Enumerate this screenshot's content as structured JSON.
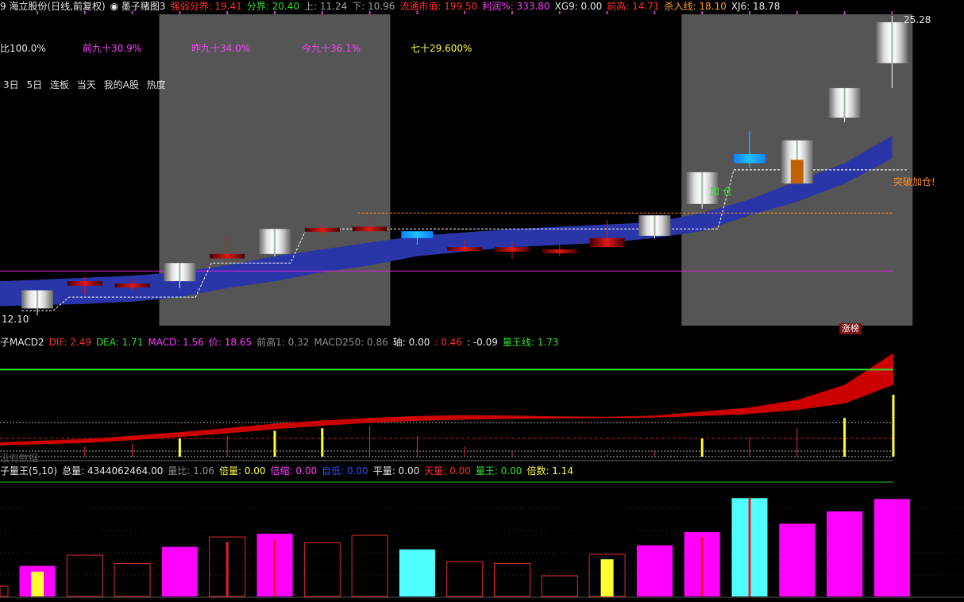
{
  "header": {
    "items": [
      {
        "text": "9 海立股份(日线,前复权)",
        "color": "#e8e8e8"
      },
      {
        "text": "◉ 墨子赌图3",
        "color": "#e8e8e8"
      },
      {
        "text": "强弱分界: 19.41",
        "color": "#ff3030"
      },
      {
        "text": "分界: 20.40",
        "color": "#30e030"
      },
      {
        "text": "上: 11.24",
        "color": "#a0a0a0"
      },
      {
        "text": "下: 10.96",
        "color": "#a0a0a0"
      },
      {
        "text": "流通市值: 199.50",
        "color": "#ff3030"
      },
      {
        "text": "利润%: 333.80",
        "color": "#ff40ff"
      },
      {
        "text": "XG9: 0.00",
        "color": "#e8e8e8"
      },
      {
        "text": "前高: 14.71",
        "color": "#ff3030"
      },
      {
        "text": "杀入线: 18.10",
        "color": "#ffa020"
      },
      {
        "text": "XJ6: 18.78",
        "color": "#e8e8e8"
      }
    ]
  },
  "pct_labels": [
    {
      "text": "比100.0%",
      "color": "#e8e8e8"
    },
    {
      "text": "前九十30.9%",
      "color": "#ff40ff"
    },
    {
      "text": "昨九十34.0%",
      "color": "#ff40ff"
    },
    {
      "text": "今九十36.1%",
      "color": "#ff40ff"
    },
    {
      "text": "七十29.600%",
      "color": "#ffff40"
    }
  ],
  "quick_tabs": [
    "3日",
    "5日",
    "连板",
    "当天",
    "我的A股",
    "热度"
  ],
  "price": {
    "high_label": "25.28",
    "low_label": "12.10",
    "breakout_label": "突破加仓!",
    "add_label": "加 仓",
    "limit_up_badge": "涨榜",
    "candles": [
      {
        "o": 12.4,
        "h": 12.8,
        "l": 12.1,
        "c": 13.2,
        "style": "white"
      },
      {
        "o": 13.4,
        "h": 13.8,
        "l": 13.0,
        "c": 13.6,
        "style": "red"
      },
      {
        "o": 13.4,
        "h": 13.7,
        "l": 13.2,
        "c": 13.5,
        "style": "red"
      },
      {
        "o": 13.6,
        "h": 14.4,
        "l": 13.3,
        "c": 14.4,
        "style": "white"
      },
      {
        "o": 14.6,
        "h": 15.6,
        "l": 14.4,
        "c": 14.8,
        "style": "red"
      },
      {
        "o": 14.8,
        "h": 15.9,
        "l": 14.7,
        "c": 15.9,
        "style": "white"
      },
      {
        "o": 15.9,
        "h": 16.1,
        "l": 15.6,
        "c": 15.95,
        "style": "red"
      },
      {
        "o": 15.8,
        "h": 16.6,
        "l": 15.7,
        "c": 16.0,
        "style": "red"
      },
      {
        "o": 15.5,
        "h": 15.6,
        "l": 15.2,
        "c": 15.8,
        "style": "cyan"
      },
      {
        "o": 15.1,
        "h": 15.4,
        "l": 14.9,
        "c": 15.0,
        "style": "red"
      },
      {
        "o": 15.1,
        "h": 15.3,
        "l": 14.6,
        "c": 14.9,
        "style": "red"
      },
      {
        "o": 15.0,
        "h": 15.2,
        "l": 14.7,
        "c": 14.9,
        "style": "red"
      },
      {
        "o": 15.5,
        "h": 16.3,
        "l": 15.1,
        "c": 15.1,
        "style": "red"
      },
      {
        "o": 15.6,
        "h": 16.5,
        "l": 15.5,
        "c": 16.5,
        "style": "white"
      },
      {
        "o": 17.0,
        "h": 18.4,
        "l": 16.8,
        "c": 18.4,
        "style": "white"
      },
      {
        "o": 18.8,
        "h": 20.2,
        "l": 18.6,
        "c": 19.2,
        "style": "cyan"
      },
      {
        "o": 17.9,
        "h": 19.8,
        "l": 17.9,
        "c": 19.8,
        "style": "white"
      },
      {
        "o": 20.8,
        "h": 22.1,
        "l": 20.6,
        "c": 22.1,
        "style": "white"
      },
      {
        "o": 23.2,
        "h": 25.28,
        "l": 22.1,
        "c": 25.0,
        "style": "white"
      }
    ],
    "band_upper": [
      13.6,
      13.75,
      13.85,
      14.0,
      14.3,
      14.7,
      15.0,
      15.3,
      15.6,
      15.75,
      15.9,
      16.0,
      16.1,
      16.2,
      16.6,
      17.2,
      18.0,
      18.8,
      20.0
    ],
    "band_lower": [
      12.5,
      12.6,
      12.7,
      12.9,
      13.3,
      13.6,
      14.0,
      14.3,
      14.7,
      14.9,
      15.1,
      15.2,
      15.3,
      15.5,
      15.8,
      16.5,
      17.1,
      17.9,
      19.0
    ],
    "stair": [
      12.3,
      12.9,
      12.9,
      12.9,
      14.4,
      14.4,
      15.9,
      15.9,
      15.9,
      15.9,
      15.9,
      15.9,
      15.9,
      15.9,
      15.9,
      18.5,
      18.5,
      18.5,
      18.5
    ],
    "resistance": 16.6,
    "support": 14.05,
    "shaded": [
      [
        3,
        7
      ],
      [
        14,
        18
      ]
    ]
  },
  "macd": {
    "header": [
      {
        "text": "子MACD2",
        "color": "#e8e8e8"
      },
      {
        "text": "DIF: 2.49",
        "color": "#ff3030"
      },
      {
        "text": "DEA: 1.71",
        "color": "#30e030"
      },
      {
        "text": "MACD: 1.56",
        "color": "#ff40ff"
      },
      {
        "text": "价: 18.65",
        "color": "#ff40ff"
      },
      {
        "text": "前高1: 0.32",
        "color": "#909090"
      },
      {
        "text": "MACD250: 0.86",
        "color": "#909090"
      },
      {
        "text": "轴: 0.00",
        "color": "#e8e8e8"
      },
      {
        "text": ": 0.46",
        "color": "#ff3030"
      },
      {
        "text": ": -0.09",
        "color": "#e8e8e8"
      },
      {
        "text": "量王线: 1.73",
        "color": "#30e030"
      }
    ],
    "watermark": "没有数据",
    "dif": [
      0.3,
      0.38,
      0.46,
      0.55,
      0.65,
      0.76,
      0.84,
      0.9,
      0.95,
      0.97,
      0.96,
      0.94,
      0.93,
      0.96,
      1.06,
      1.16,
      1.35,
      1.72,
      2.49
    ],
    "dea": [
      0.22,
      0.28,
      0.35,
      0.43,
      0.52,
      0.62,
      0.71,
      0.78,
      0.83,
      0.86,
      0.88,
      0.89,
      0.9,
      0.91,
      0.95,
      1.0,
      1.1,
      1.26,
      1.71
    ],
    "bars": [
      0.0,
      0.2,
      0.25,
      0.35,
      0.4,
      0.5,
      0.55,
      0.6,
      0.4,
      0.2,
      0.1,
      0.06,
      0.04,
      0.1,
      0.35,
      0.38,
      0.55,
      0.75,
      1.2
    ],
    "bar_yellow": [
      false,
      false,
      false,
      true,
      false,
      true,
      true,
      false,
      false,
      false,
      false,
      false,
      false,
      false,
      true,
      false,
      false,
      true,
      true
    ],
    "green_line": 2.1
  },
  "volume": {
    "header": [
      {
        "text": "子量王(5,10)",
        "color": "#e8e8e8"
      },
      {
        "text": "总量: 4344062464.00",
        "color": "#e8e8e8"
      },
      {
        "text": "量比: 1.06",
        "color": "#909090"
      },
      {
        "text": "倍量: 0.00",
        "color": "#ffff40"
      },
      {
        "text": "倍缩: 0.00",
        "color": "#ff40ff"
      },
      {
        "text": "自低: 0.00",
        "color": "#3050ff"
      },
      {
        "text": "平量: 0.00",
        "color": "#e8e8e8"
      },
      {
        "text": "天量: 0.00",
        "color": "#ff3030"
      },
      {
        "text": "量王: 0.00",
        "color": "#30e030"
      },
      {
        "text": "倍数: 1.14",
        "color": "#ffff40"
      }
    ],
    "values": [
      37,
      50,
      40,
      60,
      72,
      76,
      65,
      74,
      57,
      42,
      40,
      25,
      51,
      62,
      78,
      119,
      88,
      103,
      118
    ],
    "style": [
      "magenta",
      "hollow",
      "hollow",
      "magenta",
      "hollow",
      "magenta",
      "hollow",
      "hollow",
      "cyan",
      "hollow",
      "hollow",
      "hollow",
      "hollow",
      "magenta",
      "magenta",
      "cyan",
      "magenta",
      "magenta",
      "magenta"
    ],
    "inner_yellow": [
      30,
      0,
      0,
      0,
      0,
      0,
      0,
      0,
      0,
      0,
      0,
      0,
      45,
      0,
      0,
      0,
      0,
      0,
      0
    ],
    "inner_red": [
      0,
      0,
      0,
      0,
      66,
      68,
      0,
      0,
      0,
      0,
      0,
      0,
      0,
      0,
      72,
      119,
      0,
      0,
      0
    ]
  },
  "colors": {
    "band": "#2a35a8",
    "shade": "#555555",
    "red_body": "#c81010",
    "cyan_body": "#20a0ff",
    "macd_fill": "#cc0000",
    "magenta": "#ff00ff",
    "cyan_vol": "#50ffff"
  }
}
